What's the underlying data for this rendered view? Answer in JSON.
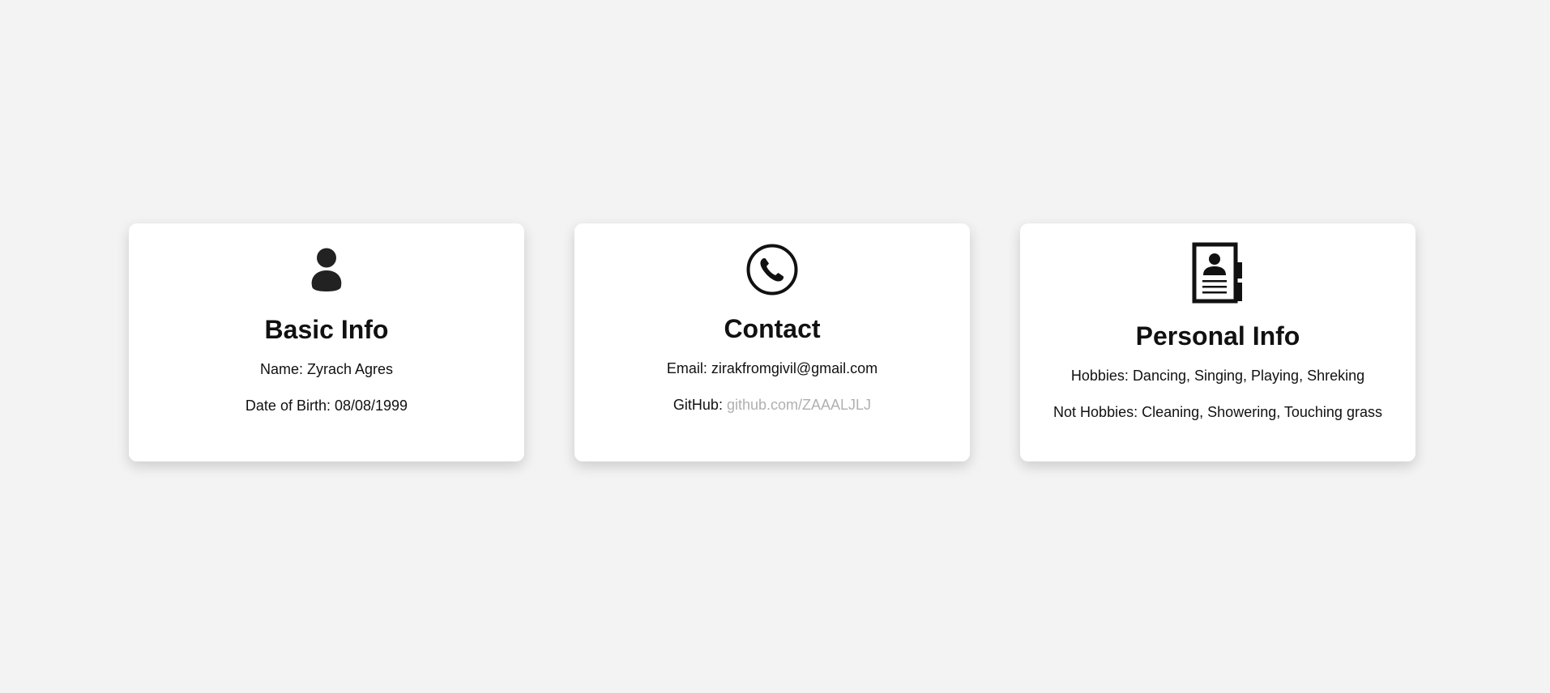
{
  "cards": [
    {
      "icon": "person-icon",
      "title": "Basic Info",
      "name_label": "Name:",
      "name_value": "Zyrach Agres",
      "dob_label": "Date of Birth:",
      "dob_value": "08/08/1999"
    },
    {
      "icon": "phone-icon",
      "title": "Contact",
      "email_label": "Email:",
      "email_value": "zirakfromgivil@gmail.com",
      "github_label": "GitHub:",
      "github_link": "github.com/ZAAALJLJ"
    },
    {
      "icon": "contact-book-icon",
      "title": "Personal Info",
      "hobbies_label": "Hobbies:",
      "hobbies_value": "Dancing, Singing, Playing, Shreking",
      "not_hobbies_label": "Not Hobbies:",
      "not_hobbies_value": "Cleaning, Showering, Touching grass"
    }
  ],
  "colors": {
    "background": "#f3f3f3",
    "card": "#ffffff",
    "text": "#111111",
    "link": "#b0b0b0"
  }
}
